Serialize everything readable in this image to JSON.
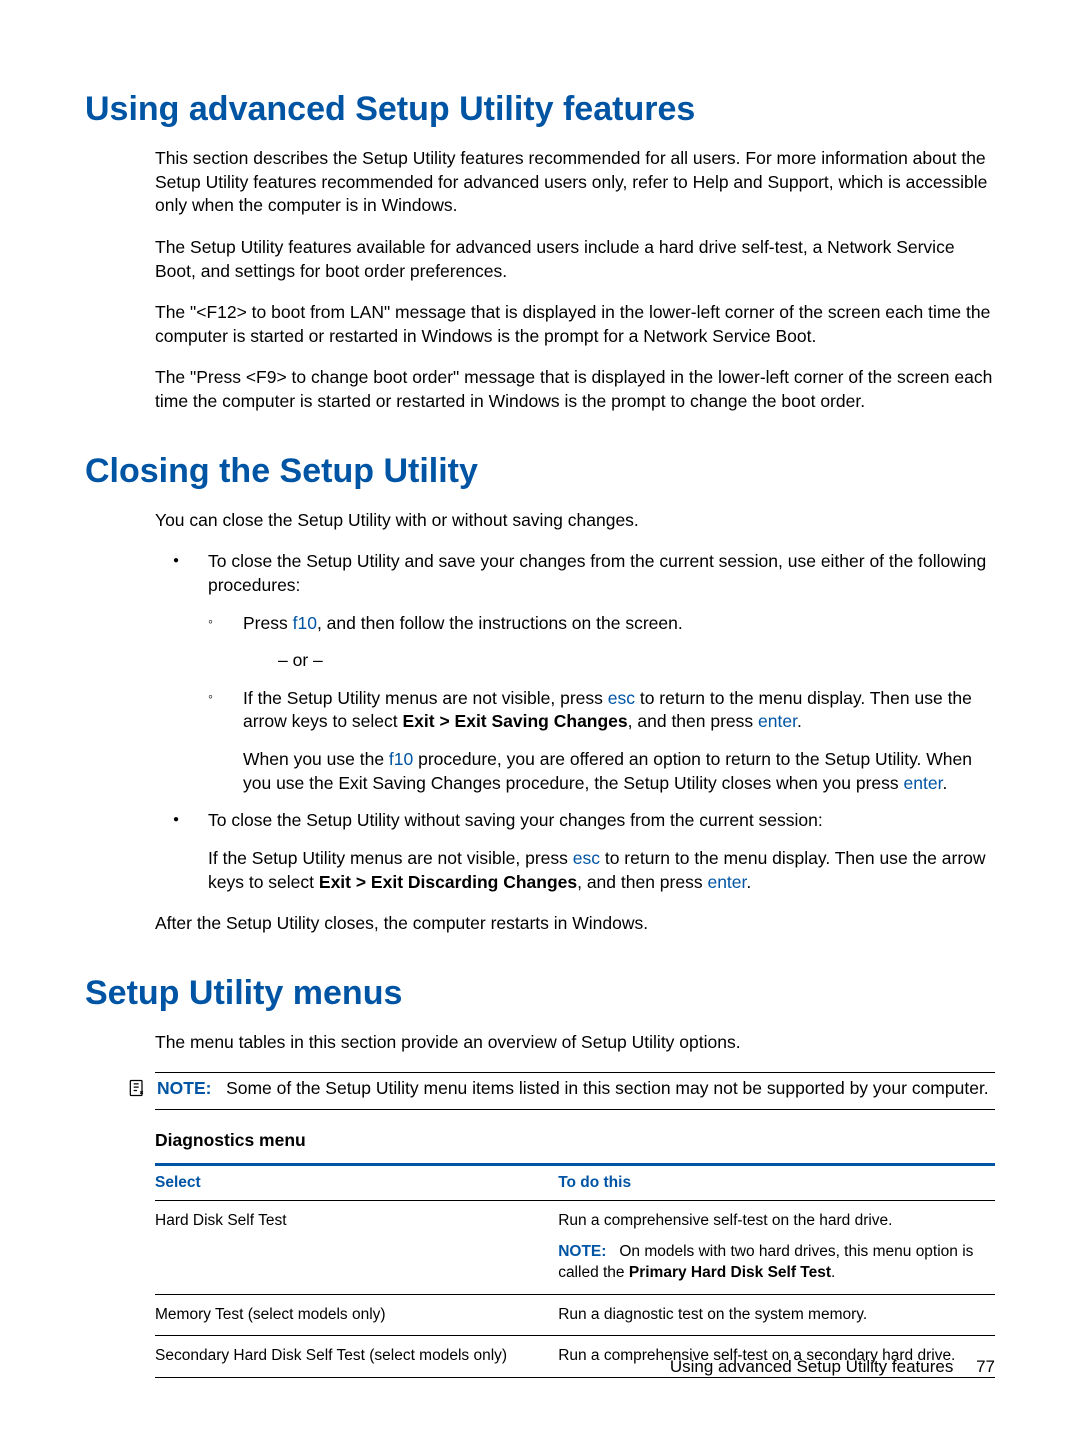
{
  "sections": {
    "s1": {
      "title": "Using advanced Setup Utility features",
      "p1": "This section describes the Setup Utility features recommended for all users. For more information about the Setup Utility features recommended for advanced users only, refer to Help and Support, which is accessible only when the computer is in Windows.",
      "p2": "The Setup Utility features available for advanced users include a hard drive self-test, a Network Service Boot, and settings for boot order preferences.",
      "p3": "The \"<F12> to boot from LAN\" message that is displayed in the lower-left corner of the screen each time the computer is started or restarted in Windows is the prompt for a Network Service Boot.",
      "p4": "The \"Press <F9> to change boot order\" message that is displayed in the lower-left corner of the screen each time the computer is started or restarted in Windows is the prompt to change the boot order."
    },
    "s2": {
      "title": "Closing the Setup Utility",
      "intro": "You can close the Setup Utility with or without saving changes.",
      "b1": "To close the Setup Utility and save your changes from the current session, use either of the following procedures:",
      "b1a_pre": "Press ",
      "b1a_key": "f10",
      "b1a_post": ", and then follow the instructions on the screen.",
      "or": "– or –",
      "b1b_pre": "If the Setup Utility menus are not visible, press ",
      "b1b_key1": "esc",
      "b1b_mid": " to return to the menu display. Then use the arrow keys to select ",
      "b1b_bold": "Exit > Exit Saving Changes",
      "b1b_post": ", and then press ",
      "b1b_key2": "enter",
      "b1b_end": ".",
      "b1b_note_pre": "When you use the ",
      "b1b_note_key1": "f10",
      "b1b_note_mid": " procedure, you are offered an option to return to the Setup Utility. When you use the Exit Saving Changes procedure, the Setup Utility closes when you press ",
      "b1b_note_key2": "enter",
      "b1b_note_end": ".",
      "b2": "To close the Setup Utility without saving your changes from the current session:",
      "b2_p_pre": "If the Setup Utility menus are not visible, press ",
      "b2_p_key1": "esc",
      "b2_p_mid": " to return to the menu display. Then use the arrow keys to select ",
      "b2_p_bold": "Exit > Exit Discarding Changes",
      "b2_p_post": ", and then press ",
      "b2_p_key2": "enter",
      "b2_p_end": ".",
      "outro": "After the Setup Utility closes, the computer restarts in Windows."
    },
    "s3": {
      "title": "Setup Utility menus",
      "intro": "The menu tables in this section provide an overview of Setup Utility options.",
      "note_label": "NOTE:",
      "note_text": "Some of the Setup Utility menu items listed in this section may not be supported by your computer.",
      "subhead": "Diagnostics menu",
      "th1": "Select",
      "th2": "To do this",
      "rows": [
        {
          "select": "Hard Disk Self Test",
          "do": "Run a comprehensive self-test on the hard drive.",
          "note_label": "NOTE:",
          "note_pre": "On models with two hard drives, this menu option is called the ",
          "note_bold": "Primary Hard Disk Self Test",
          "note_end": "."
        },
        {
          "select": "Memory Test (select models only)",
          "do": "Run a diagnostic test on the system memory."
        },
        {
          "select": "Secondary Hard Disk Self Test (select models only)",
          "do": "Run a comprehensive self-test on a secondary hard drive."
        }
      ]
    }
  },
  "footer": {
    "text": "Using advanced Setup Utility features",
    "page": "77"
  }
}
